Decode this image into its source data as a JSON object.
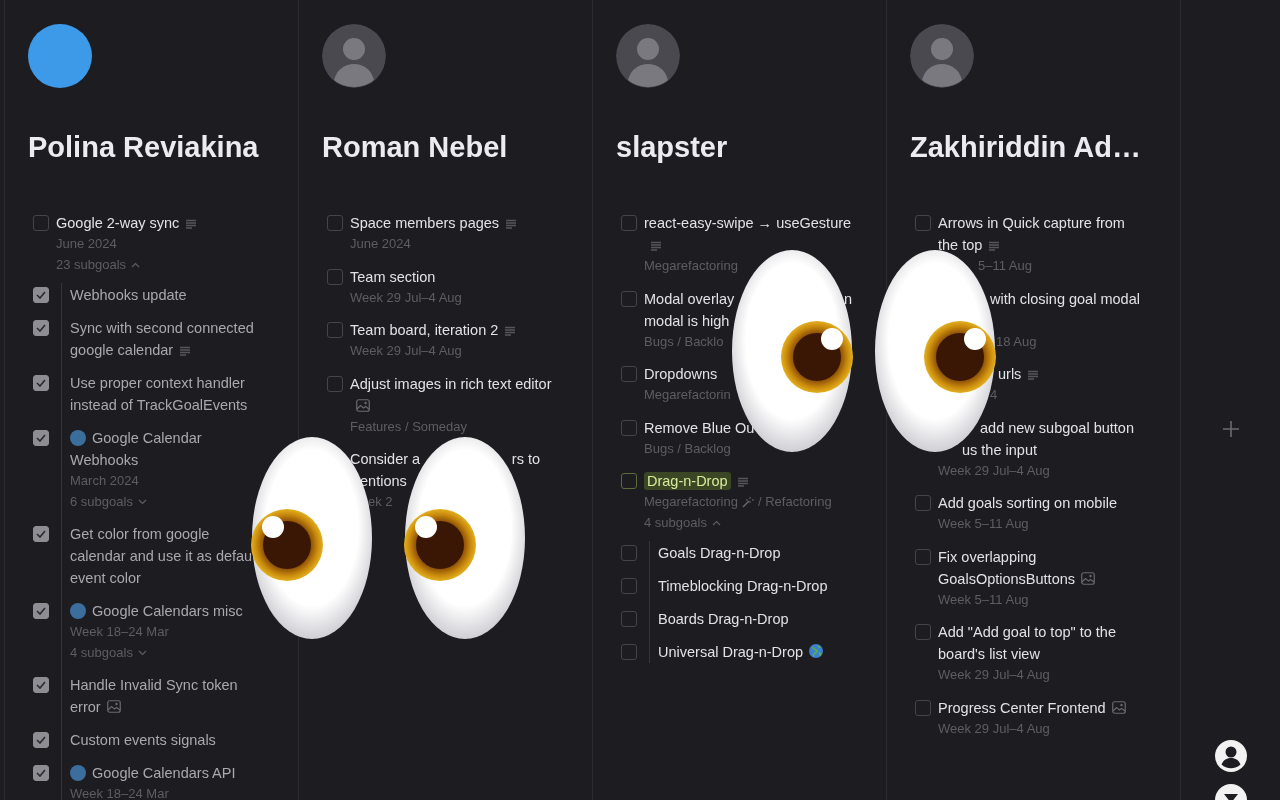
{
  "columns": [
    {
      "name": "Polina Reviakina",
      "avatar": {
        "kind": "solid",
        "color": "#3d9ae8"
      },
      "items": [
        {
          "checked": false,
          "highlighted": false,
          "title": [
            "Google 2-way sync"
          ],
          "note": true,
          "meta": "June 2024",
          "subgoals": "23 subgoals",
          "expanded": true,
          "children": [
            {
              "checked": true,
              "title": [
                "Webhooks update"
              ]
            },
            {
              "checked": true,
              "title": [
                "Sync with second connected",
                "google calendar"
              ],
              "note": true
            },
            {
              "checked": true,
              "title": [
                "Use proper context handler",
                "instead of TrackGoalEvents"
              ]
            },
            {
              "checked": true,
              "dot": true,
              "title": [
                "Google Calendar",
                "Webhooks"
              ],
              "meta": "March 2024",
              "subgoals": "6 subgoals",
              "expanded": false
            },
            {
              "checked": true,
              "title": [
                "Get color from google",
                "calendar and use it as defau",
                "event color"
              ]
            },
            {
              "checked": true,
              "dot": true,
              "title": [
                "Google Calendars misc"
              ],
              "meta": "Week 18–24 Mar",
              "subgoals": "4 subgoals",
              "expanded": false
            },
            {
              "checked": true,
              "title": [
                "Handle Invalid Sync token",
                "error"
              ],
              "image": true
            },
            {
              "checked": true,
              "title": [
                "Custom events signals"
              ]
            },
            {
              "checked": true,
              "dot": true,
              "title": [
                "Google Calendars API"
              ],
              "meta": "Week 18–24 Mar"
            }
          ]
        }
      ]
    },
    {
      "name": "Roman Nebel",
      "avatar": {
        "kind": "photo"
      },
      "items": [
        {
          "checked": false,
          "highlighted": false,
          "title": [
            "Space members pages"
          ],
          "note": true,
          "meta": "June 2024"
        },
        {
          "checked": false,
          "highlighted": false,
          "title": [
            "Team section"
          ],
          "meta": "Week 29 Jul–4 Aug"
        },
        {
          "checked": false,
          "highlighted": false,
          "title": [
            "Team board, iteration 2"
          ],
          "note": true,
          "meta": "Week 29 Jul–4 Aug"
        },
        {
          "checked": false,
          "highlighted": false,
          "title": [
            "Adjust images in rich text editor"
          ],
          "image": true,
          "meta": "Features / Someday"
        },
        {
          "highlighted": false,
          "title": [
            "Consider a",
            "entions"
          ],
          "title_tail": "rs to",
          "meta": "ek 2"
        }
      ]
    },
    {
      "name": "slapster",
      "avatar": {
        "kind": "photo"
      },
      "items": [
        {
          "checked": false,
          "highlighted": false,
          "title": [
            "react-easy-swipe → useGesture"
          ],
          "note": true,
          "meta": "Megarefactoring"
        },
        {
          "checked": false,
          "highlighted": false,
          "title": [
            "Modal overlay",
            "modal is high"
          ],
          "title_tail": "n",
          "meta": "Bugs / Backlo"
        },
        {
          "checked": false,
          "highlighted": false,
          "title": [
            "Dropdowns"
          ],
          "meta": "Megarefactorin"
        },
        {
          "checked": false,
          "highlighted": false,
          "title": [
            "Remove Blue Ou"
          ],
          "meta": "Bugs / Backlog"
        },
        {
          "checked": false,
          "highlighted": true,
          "title": [
            "Drag-n-Drop"
          ],
          "note": true,
          "meta": "Megarefactoring",
          "wand": true,
          "meta_after": "/ Refactoring",
          "subgoals": "4 subgoals",
          "expanded": true,
          "children": [
            {
              "checked": false,
              "title": [
                "Goals Drag-n-Drop"
              ]
            },
            {
              "checked": false,
              "title": [
                "Timeblocking Drag-n-Drop"
              ]
            },
            {
              "checked": false,
              "title": [
                "Boards Drag-n-Drop"
              ]
            },
            {
              "checked": false,
              "title": [
                "Universal Drag-n-Drop"
              ],
              "globe": true
            }
          ]
        }
      ]
    },
    {
      "name": "Zakhiriddin Ad…",
      "avatar": {
        "kind": "photo"
      },
      "items": [
        {
          "checked": false,
          "highlighted": false,
          "title": [
            "Arrows in Quick capture from",
            "the top"
          ],
          "note": true,
          "meta": "5–11 Aug"
        },
        {
          "highlighted": false,
          "title": [
            "with closing goal modal"
          ],
          "meta": "18 Aug"
        },
        {
          "highlighted": false,
          "title": [
            "urls"
          ],
          "note": true,
          "meta": "4"
        },
        {
          "highlighted": false,
          "title": [
            "add new subgoal button",
            "us the input"
          ],
          "meta": "Week 29 Jul–4 Aug"
        },
        {
          "checked": false,
          "highlighted": false,
          "title": [
            "Add goals sorting on mobile"
          ],
          "meta": "Week 5–11 Aug"
        },
        {
          "checked": false,
          "highlighted": false,
          "title": [
            "Fix overlapping",
            "GoalsOptionsButtons"
          ],
          "image": true,
          "meta": "Week 5–11 Aug"
        },
        {
          "checked": false,
          "highlighted": false,
          "title": [
            "Add \"Add goal to top\" to the",
            "board's list view"
          ],
          "meta": "Week 29 Jul–4 Aug"
        },
        {
          "checked": false,
          "highlighted": false,
          "title": [
            "Progress Center Frontend"
          ],
          "image": true,
          "meta": "Week 29 Jul–4 Aug"
        }
      ]
    }
  ]
}
